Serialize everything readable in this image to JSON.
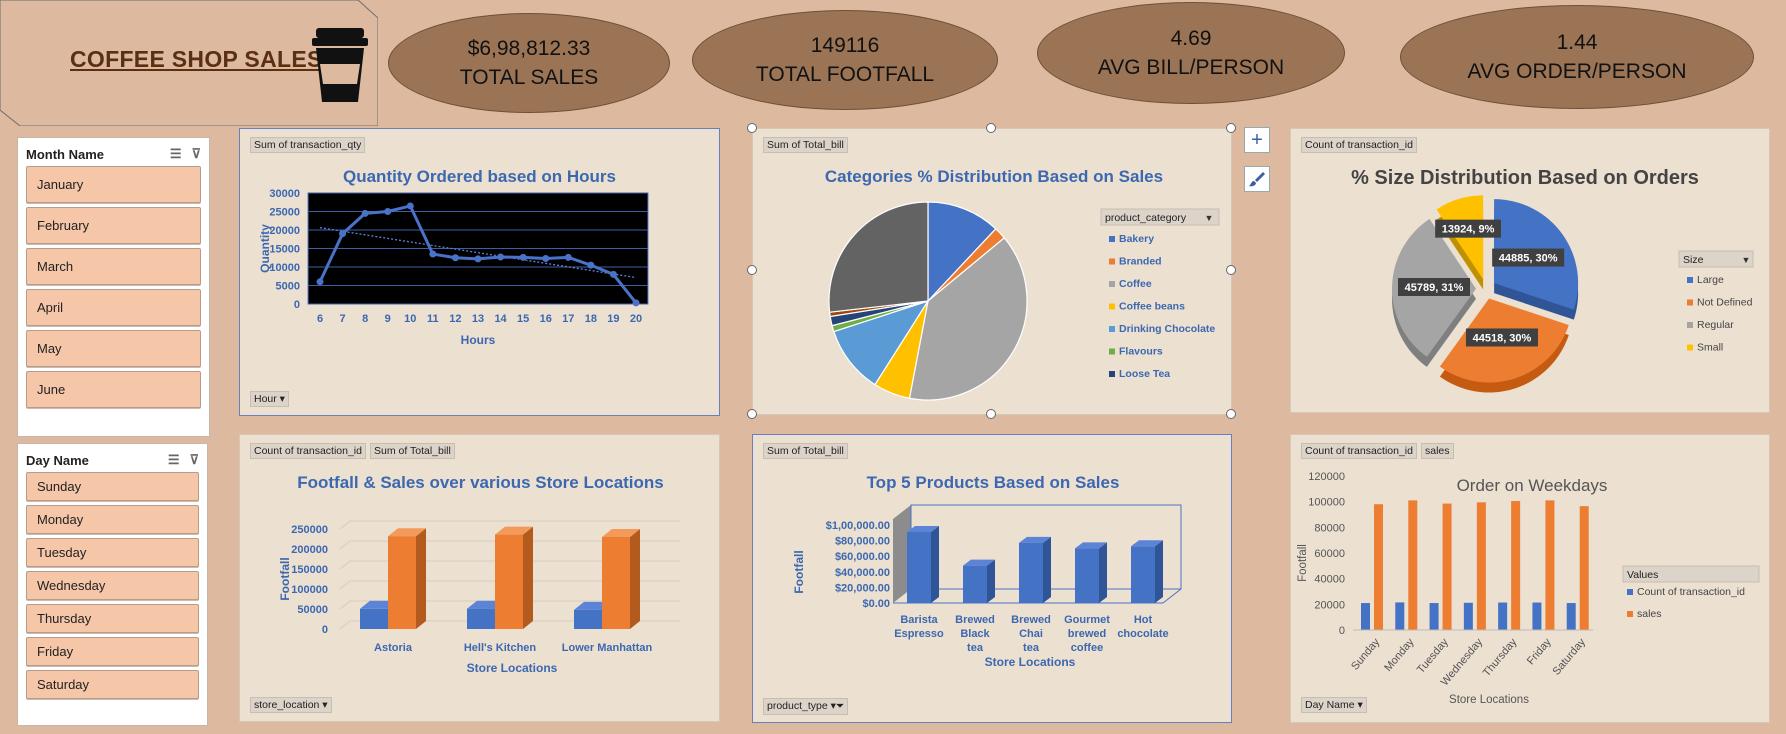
{
  "header": {
    "title": "COFFEE SHOP SALES"
  },
  "kpis": [
    {
      "value": "$6,98,812.33",
      "label": "TOTAL SALES"
    },
    {
      "value": "149116",
      "label": "TOTAL FOOTFALL"
    },
    {
      "value": "4.69",
      "label": "AVG BILL/PERSON"
    },
    {
      "value": "1.44",
      "label": "AVG ORDER/PERSON"
    }
  ],
  "month_slicer": {
    "title": "Month Name",
    "items": [
      "January",
      "February",
      "March",
      "April",
      "May",
      "June"
    ]
  },
  "day_slicer": {
    "title": "Day Name",
    "items": [
      "Sunday",
      "Monday",
      "Tuesday",
      "Wednesday",
      "Thursday",
      "Friday",
      "Saturday"
    ]
  },
  "panels": {
    "qty": {
      "tag": "Sum of transaction_qty",
      "filter": "Hour"
    },
    "cat": {
      "tag": "Sum of Total_bill"
    },
    "size": {
      "tag": "Count of transaction_id"
    },
    "foot": {
      "tag1": "Count of transaction_id",
      "tag2": "Sum of Total_bill",
      "filter": "store_location"
    },
    "top5": {
      "tag": "Sum of Total_bill",
      "filter": "product_type"
    },
    "week": {
      "tag1": "Count of transaction_id",
      "tag2": "sales",
      "filter": "Day Name"
    }
  },
  "chart_data": [
    {
      "type": "line",
      "title": "Quantity Ordered based on Hours",
      "xlabel": "Hours",
      "ylabel": "Quantity",
      "x": [
        6,
        7,
        8,
        9,
        10,
        11,
        12,
        13,
        14,
        15,
        16,
        17,
        18,
        19,
        20
      ],
      "y": [
        6000,
        19000,
        24500,
        25000,
        26500,
        13500,
        12500,
        12200,
        12700,
        12600,
        12300,
        12600,
        10500,
        8000,
        300
      ],
      "ylim": [
        0,
        30000
      ],
      "yticks": [
        0,
        5000,
        10000,
        15000,
        20000,
        25000,
        30000
      ],
      "trendline": true
    },
    {
      "type": "pie",
      "title": "Categories % Distribution Based on Sales",
      "legend_title": "product_category",
      "slices": [
        {
          "name": "Bakery",
          "value": 12,
          "color": "#4472c4"
        },
        {
          "name": "Branded",
          "value": 2,
          "color": "#ed7d31"
        },
        {
          "name": "Coffee",
          "value": 39,
          "color": "#a5a5a5"
        },
        {
          "name": "Coffee beans",
          "value": 6,
          "color": "#ffc000"
        },
        {
          "name": "Drinking Chocolate",
          "value": 11,
          "color": "#5b9bd5"
        },
        {
          "name": "Flavours",
          "value": 1,
          "color": "#70ad47"
        },
        {
          "name": "Loose Tea",
          "value": 1.5,
          "color": "#264478"
        },
        {
          "name": "",
          "value": 0.7,
          "color": "#9e480e"
        },
        {
          "name": "",
          "value": 26.8,
          "color": "#636363"
        }
      ]
    },
    {
      "type": "pie",
      "title": "% Size Distribution Based on Orders",
      "legend_title": "Size",
      "slices": [
        {
          "name": "Large",
          "value": 44885,
          "label": "44885, 30%",
          "color": "#4472c4"
        },
        {
          "name": "Not Defined",
          "value": 44518,
          "label": "44518, 30%",
          "color": "#ed7d31"
        },
        {
          "name": "Regular",
          "value": 45789,
          "label": "45789, 31%",
          "color": "#a5a5a5"
        },
        {
          "name": "Small",
          "value": 13924,
          "label": "13924, 9%",
          "color": "#ffc000"
        }
      ]
    },
    {
      "type": "bar",
      "title": "Footfall & Sales over various Store Locations",
      "xlabel": "Store Locations",
      "ylabel": "Footfall",
      "categories": [
        "Astoria",
        "Hell's Kitchen",
        "Lower Manhattan"
      ],
      "series": [
        {
          "values": [
            50500,
            50700,
            47800
          ],
          "color": "#4472c4"
        },
        {
          "values": [
            232000,
            236000,
            230000
          ],
          "color": "#ed7d31"
        }
      ],
      "ylim": [
        0,
        250000
      ],
      "yticks": [
        0,
        50000,
        100000,
        150000,
        200000,
        250000
      ]
    },
    {
      "type": "bar",
      "title": "Top 5 Products Based on Sales",
      "xlabel": "Store Locations",
      "ylabel": "Footfall",
      "categories": [
        "Barista Espresso",
        "Brewed Black tea",
        "Brewed Chai tea",
        "Gourmet brewed coffee",
        "Hot chocolate"
      ],
      "values": [
        91000,
        47900,
        77100,
        70000,
        72700
      ],
      "ylim": [
        0,
        100000
      ],
      "yticks": [
        "$0.00",
        "$20,000.00",
        "$40,000.00",
        "$60,000.00",
        "$80,000.00",
        "$1,00,000.00"
      ]
    },
    {
      "type": "bar",
      "title": "Order on Weekdays",
      "xlabel": "Store Locations",
      "ylabel": "Footfall",
      "legend_title": "Values",
      "categories": [
        "Sunday",
        "Monday",
        "Tuesday",
        "Wednesday",
        "Thursday",
        "Friday",
        "Saturday"
      ],
      "series": [
        {
          "name": "Count of transaction_id",
          "values": [
            21000,
            21500,
            21000,
            21200,
            21400,
            21400,
            21000
          ],
          "color": "#4472c4"
        },
        {
          "name": "sales",
          "values": [
            98000,
            101000,
            98500,
            99500,
            100500,
            101000,
            96500
          ],
          "color": "#ed7d31"
        }
      ],
      "ylim": [
        0,
        120000
      ],
      "yticks": [
        0,
        20000,
        40000,
        60000,
        80000,
        100000,
        120000
      ]
    }
  ]
}
